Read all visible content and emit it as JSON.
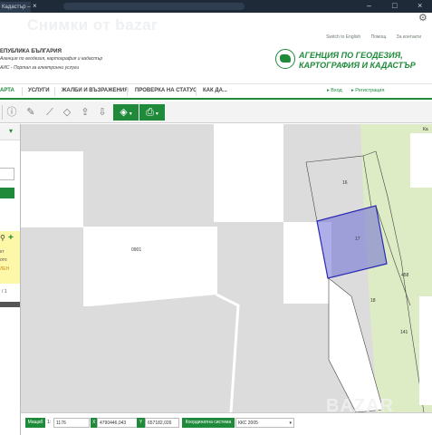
{
  "browser": {
    "tab_title": "Кадастър – Картогр...",
    "close_glyph": "×",
    "window_controls": {
      "minimize": "–",
      "maximize": "□",
      "close": "×"
    }
  },
  "watermark": "Снимки от bazar",
  "header": {
    "top_links": [
      "Switch to English",
      "Помощ",
      "За контакти"
    ],
    "brand_line1": "ЕПУБЛИКА БЪЛГАРИЯ",
    "brand_line2": "Агенция по геодезия, картография и кадастър",
    "brand_line3": "АИС - Портал за електронни услуги",
    "agency_line1": "АГЕНЦИЯ ПО ГЕОДЕЗИЯ,",
    "agency_line2": "КАРТОГРАФИЯ И КАДАСТЪР",
    "logo_icon": "bulgaria-map-logo-icon"
  },
  "nav": {
    "items": [
      "АРТА",
      "УСЛУГИ",
      "ЖАЛБИ И ВЪЗРАЖЕНИЯ",
      "ПРОВЕРКА НА СТАТУС",
      "КАК ДА..."
    ],
    "login": "▸ Вход",
    "register": "▸ Регистрация"
  },
  "toolbar": {
    "icons": [
      "info-icon",
      "edit-document-icon",
      "ruler-icon",
      "upload-icon",
      "layers-icon",
      "print-icon"
    ],
    "caret": "▾"
  },
  "leftpanel": {
    "collapse_glyph": "▾",
    "zoom_glyph": "⚲",
    "plus_glyph": "+",
    "note_lines": [
      "кт",
      "ото",
      "ЛЕН"
    ],
    "pagination": "/ 1"
  },
  "map": {
    "labels": {
      "parcel_large": "0901",
      "parcel_16": "16",
      "parcel_17": "17",
      "parcel_18": "18",
      "parcel_458": "458",
      "parcel_141": "141",
      "corner_text": "Ка"
    },
    "colors": {
      "background": "#dcdcdc",
      "parcel": "#ffffff",
      "highlight_fill": "#6b6bd6",
      "highlight_stroke": "#2a2ab5",
      "terrain": "#ddecc4"
    }
  },
  "bottombar": {
    "id_label": "Мащаб",
    "id_sep": "1:",
    "scale_value": "1176",
    "x_label": "X",
    "x_value": "4790446,043",
    "y_label": "Y",
    "y_value": "657182,026",
    "coord_label": "Координатна система",
    "coord_value": "ККС 2005",
    "caret": "▾"
  },
  "brand_watermark": "BAZAR",
  "colors": {
    "accent": "#1f8a3a"
  }
}
